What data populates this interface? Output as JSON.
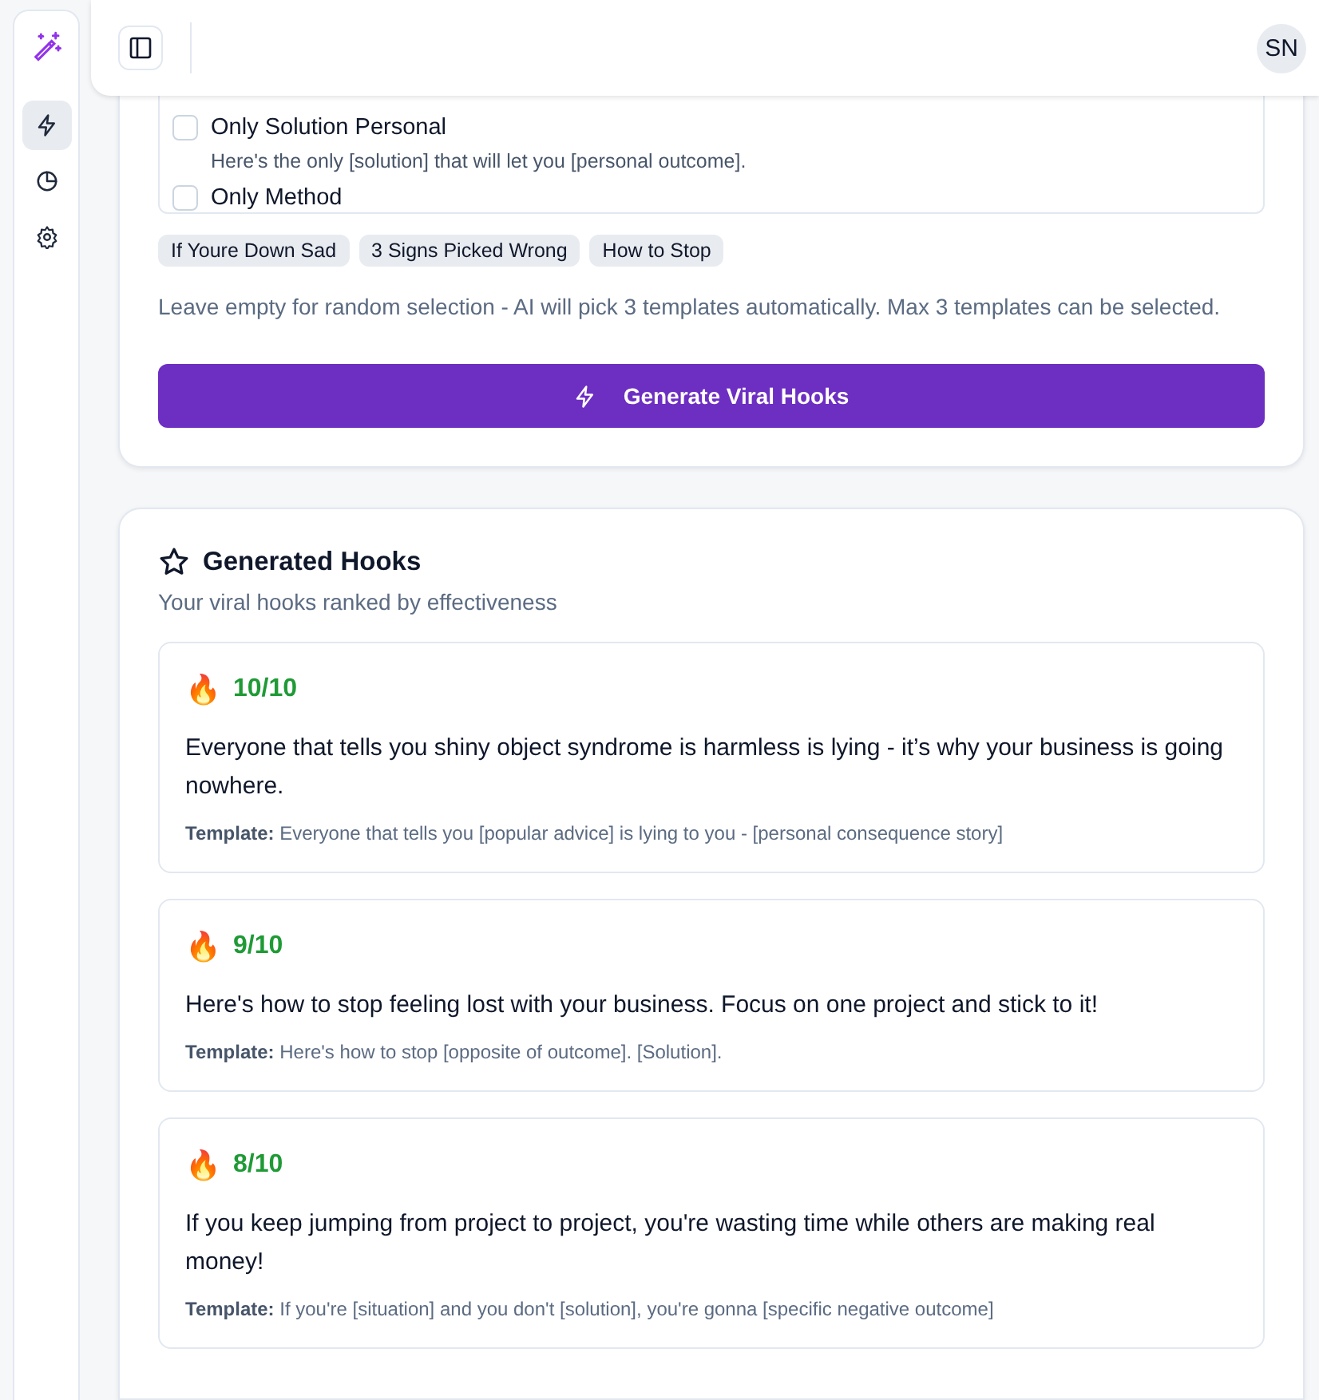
{
  "sidebar": {
    "items": [
      {
        "kind": "zap",
        "selected": true
      },
      {
        "kind": "pie",
        "selected": false
      },
      {
        "kind": "gear",
        "selected": false
      }
    ]
  },
  "header": {
    "avatar": "SN"
  },
  "templates": {
    "options": [
      {
        "name": "Only Solution Personal",
        "description": "Here's the only [solution] that will let you [personal outcome].",
        "checked": false
      },
      {
        "name": "Only Method",
        "checked": false
      }
    ],
    "selected_chips": [
      "If Youre Down Sad",
      "3 Signs Picked Wrong",
      "How to Stop"
    ],
    "help": "Leave empty for random selection - AI will pick 3 templates automatically. Max 3 templates can be selected.",
    "button": "Generate Viral Hooks"
  },
  "results": {
    "title": "Generated Hooks",
    "subtitle": "Your viral hooks ranked by effectiveness",
    "hooks": [
      {
        "icon": "🔥",
        "score": "10/10",
        "text": "Everyone that tells you shiny object syndrome is harmless is lying - it’s why your business is going nowhere.",
        "template": "**Template:** Everyone that tells you [popular advice] is lying to you - [personal consequence story]"
      },
      {
        "icon": "🔥",
        "score": "9/10",
        "text": "Here's how to stop feeling lost with your business. Focus on one project and stick to it!",
        "template": "**Template:** Here's how to stop [opposite of outcome]. [Solution]."
      },
      {
        "icon": "🔥",
        "score": "8/10",
        "text": "If you keep jumping from project to project, you're wasting time while others are making real money!",
        "template": "**Template:** If you're [situation] and you don't [solution], you're gonna [specific negative outcome]"
      }
    ]
  }
}
